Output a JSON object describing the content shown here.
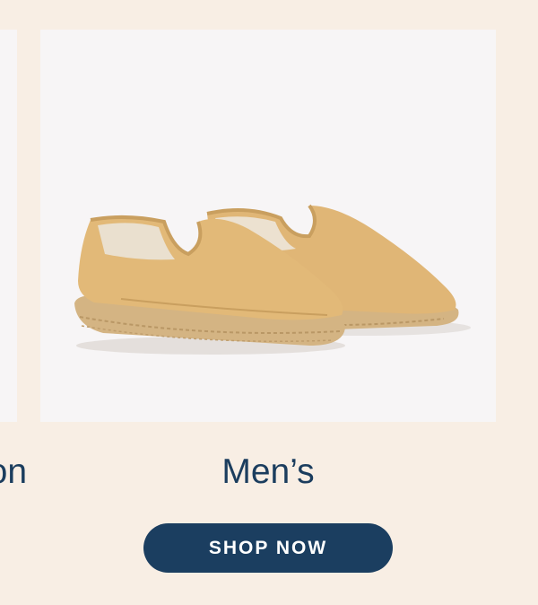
{
  "carousel": {
    "left_slide": {
      "label": "ion"
    },
    "current_slide": {
      "label": "Men’s",
      "image_alt": "espadrille-shoes"
    }
  },
  "cta": {
    "label": "SHOP NOW"
  },
  "colors": {
    "background": "#f8eee4",
    "image_background": "#f7f5f6",
    "label_text": "#1b3d5e",
    "button": "#1b3e60",
    "button_text": "#ffffff",
    "shoe_canvas": "#e2b978",
    "jute_sole": "#d4b483"
  }
}
